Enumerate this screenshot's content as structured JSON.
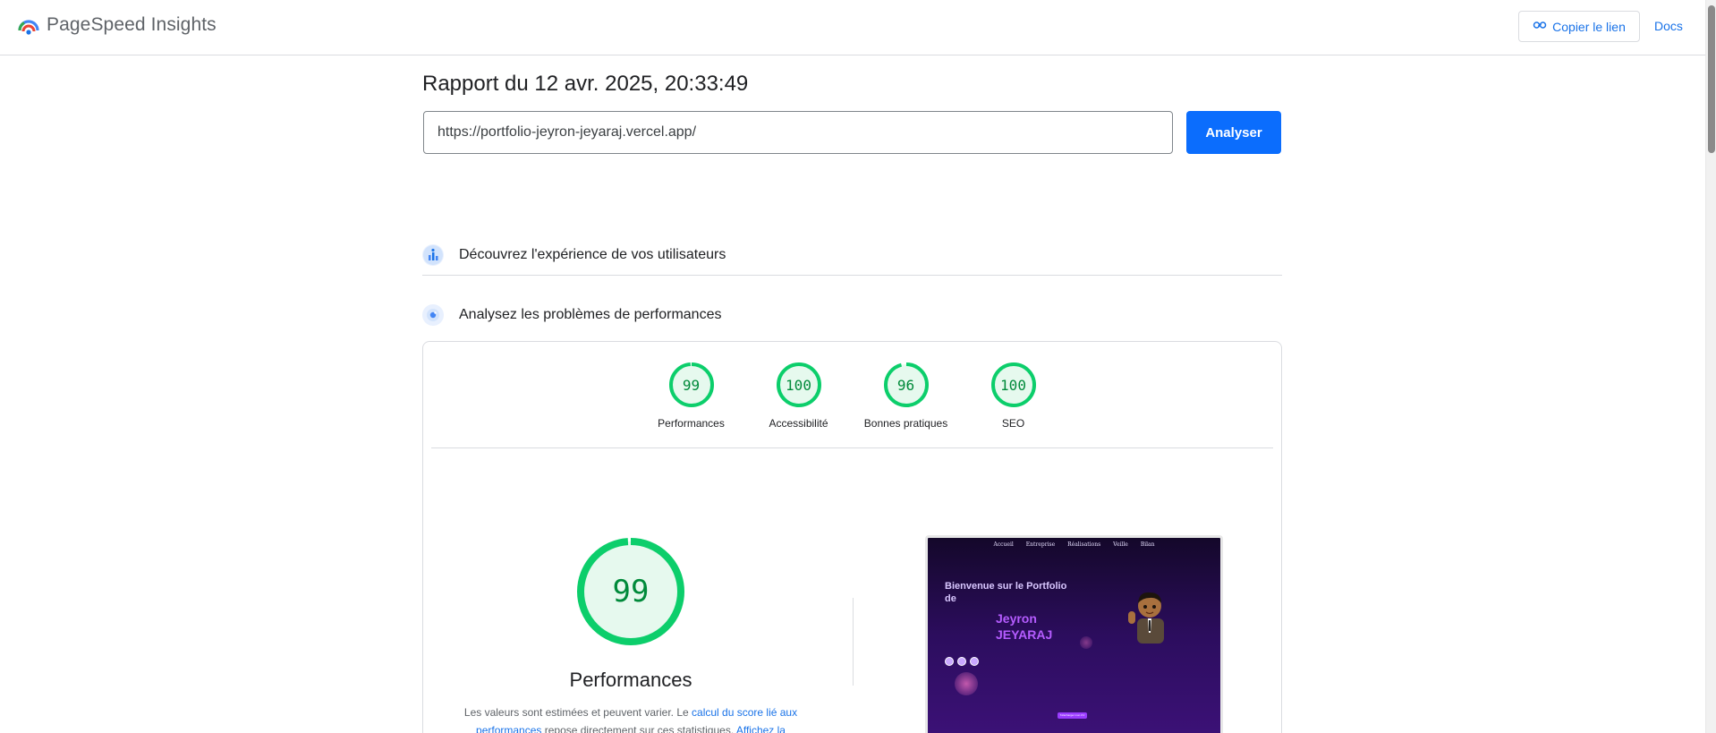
{
  "header": {
    "brand": "PageSpeed Insights",
    "copy_link_label": "Copier le lien",
    "docs_label": "Docs"
  },
  "report": {
    "title": "Rapport du 12 avr. 2025, 20:33:49",
    "url_value": "https://portfolio-jeyron-jeyaraj.vercel.app/",
    "analyze_label": "Analyser"
  },
  "sections": {
    "ux_label": "Découvrez l'expérience de vos utilisateurs",
    "perf_label": "Analysez les problèmes de performances"
  },
  "scores": [
    {
      "label": "Performances",
      "value": 99
    },
    {
      "label": "Accessibilité",
      "value": 100
    },
    {
      "label": "Bonnes pratiques",
      "value": 96
    },
    {
      "label": "SEO",
      "value": 100
    }
  ],
  "main_score": {
    "value": 99,
    "title": "Performances",
    "desc_before": "Les valeurs sont estimées et peuvent varier. Le ",
    "desc_link1": "calcul du score lié aux performances",
    "desc_middle": " repose directement sur ces statistiques. ",
    "desc_link2": "Affichez la"
  },
  "thumbnail": {
    "nav": [
      "Accueil",
      "Entreprise",
      "Réalisations",
      "Veille",
      "Bilan"
    ],
    "welcome": "Bienvenue sur le Portfolio de",
    "name_line1": "Jeyron",
    "name_line2": "JEYARAJ",
    "cta": "Télécharger mon CV"
  },
  "colors": {
    "pass_green": "#0cce6b",
    "pass_text": "#008a3a",
    "pass_fill": "#e6f9ee",
    "accent_blue": "#1a73e8",
    "button_blue": "#0b6dfd"
  }
}
